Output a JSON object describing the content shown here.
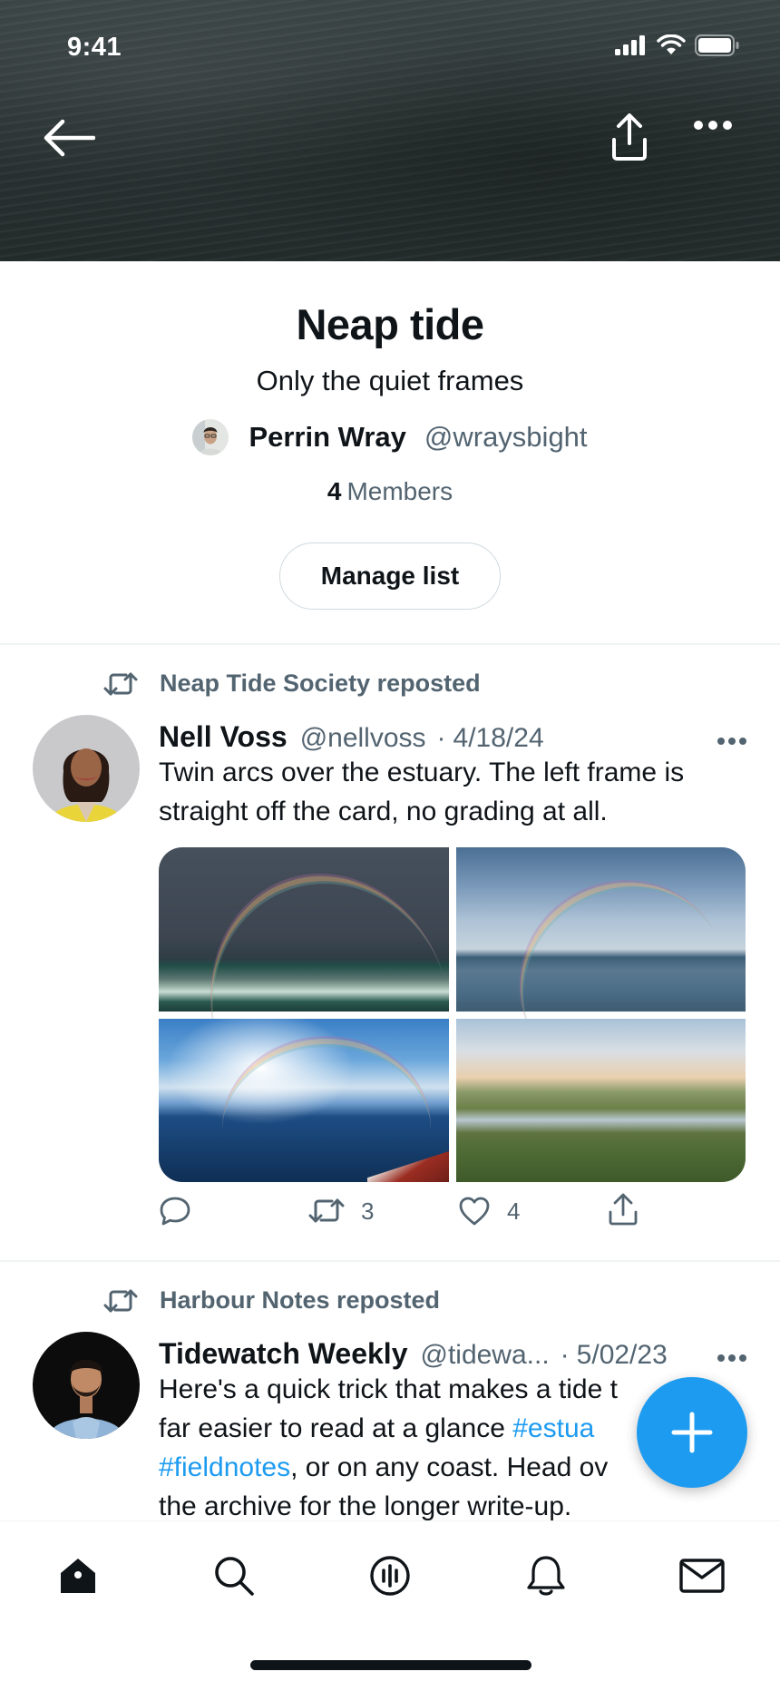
{
  "status_bar": {
    "time": "9:41"
  },
  "header": {
    "back_icon": "arrow-left-icon",
    "share_icon": "share-icon",
    "more_icon": "more-horizontal-icon"
  },
  "list": {
    "title": "Neap tide",
    "description": "Only the quiet frames",
    "owner_name": "Perrin Wray",
    "owner_handle": "@wraysbight",
    "members_count": "4",
    "members_label": "Members",
    "manage_label": "Manage list"
  },
  "posts": [
    {
      "repost_label": "Neap Tide Society reposted",
      "name": "Nell Voss",
      "handle": "@nellvoss",
      "separator": "·",
      "date": "4/18/24",
      "text": "Twin arcs over the estuary. The left frame is straight off the card, no grading at all.",
      "media_count": 4,
      "reply_count": "",
      "repost_count": "3",
      "like_count": "4"
    },
    {
      "repost_label": "Harbour Notes reposted",
      "name": "Tidewatch Weekly",
      "handle": "@tidewa...",
      "separator": "·",
      "date": "5/02/23",
      "text_lines": [
        {
          "before": "Here's a quick trick that makes a tide t",
          "tag": "",
          "after": ""
        },
        {
          "before": "far easier to read at a glance ",
          "tag": "#estua",
          "after": ""
        },
        {
          "before": "",
          "tag": "#fieldnotes",
          "after": ", or on any coast. Head ov"
        },
        {
          "before": "the archive for the longer write-up.",
          "tag": "",
          "after": ""
        }
      ]
    }
  ],
  "fab": {
    "icon": "plus-icon"
  },
  "tabbar": {
    "items": [
      {
        "icon": "home-icon",
        "active": true
      },
      {
        "icon": "search-icon",
        "active": false
      },
      {
        "icon": "spaces-icon",
        "active": false
      },
      {
        "icon": "bell-icon",
        "active": false
      },
      {
        "icon": "mail-icon",
        "active": false
      }
    ]
  },
  "colors": {
    "accent": "#1d9bf0",
    "text_primary": "#0f1419",
    "text_secondary": "#536471",
    "divider": "#eff3f4"
  }
}
